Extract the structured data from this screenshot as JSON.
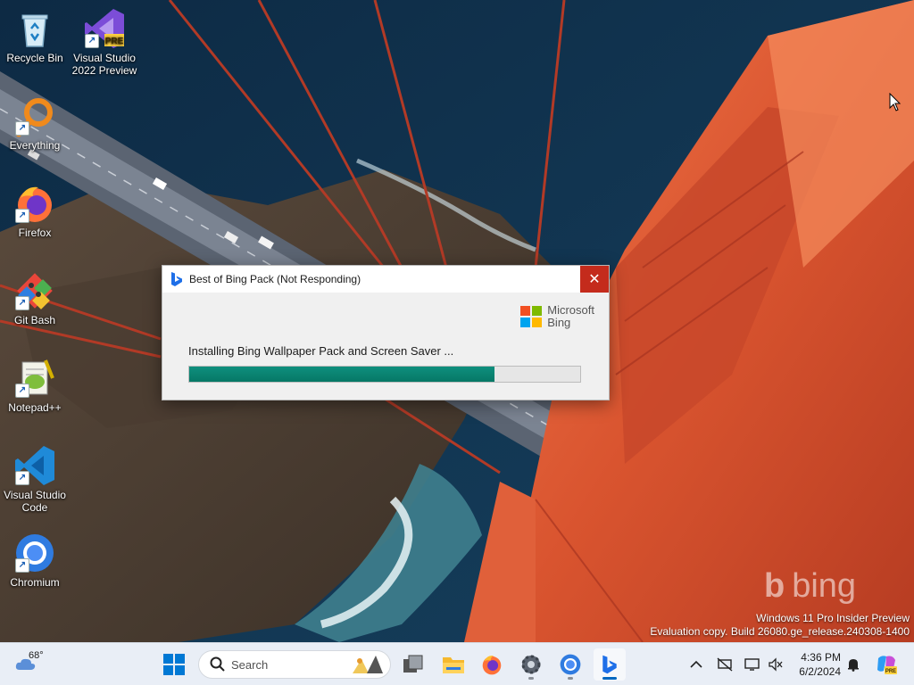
{
  "desktop": {
    "icons": [
      {
        "label": "Recycle Bin",
        "icon": "recycle-bin-icon"
      },
      {
        "label": "Visual Studio 2022 Preview",
        "icon": "visual-studio-icon",
        "badge": "PRE"
      },
      {
        "label": "Everything",
        "icon": "everything-icon"
      },
      {
        "label": "Firefox",
        "icon": "firefox-icon"
      },
      {
        "label": "Git Bash",
        "icon": "git-bash-icon"
      },
      {
        "label": "Notepad++",
        "icon": "notepad-plus-plus-icon"
      },
      {
        "label": "Visual Studio Code",
        "icon": "vscode-icon"
      },
      {
        "label": "Chromium",
        "icon": "chromium-icon"
      }
    ],
    "watermark": {
      "brand": "bing",
      "edition": "Windows 11 Pro Insider Preview",
      "build": "Evaluation copy. Build 26080.ge_release.240308-1400"
    }
  },
  "dialog": {
    "title": "Best of Bing Pack (Not Responding)",
    "logo_line1": "Microsoft",
    "logo_line2": "Bing",
    "status": "Installing Bing Wallpaper Pack and Screen Saver ...",
    "progress": 0.78
  },
  "taskbar": {
    "weather_temp": "68°",
    "search_label": "Search",
    "pinned": [
      "start",
      "search",
      "task-view",
      "file-explorer",
      "firefox",
      "settings",
      "chromium",
      "bing"
    ],
    "clock_time": "4:36 PM",
    "clock_date": "6/2/2024"
  },
  "colors": {
    "accent": "#0067c0",
    "progress": "#067866",
    "close": "#c42b1c",
    "ms_red": "#f25022",
    "ms_green": "#7fba00",
    "ms_blue": "#00a4ef",
    "ms_yellow": "#ffb900"
  }
}
